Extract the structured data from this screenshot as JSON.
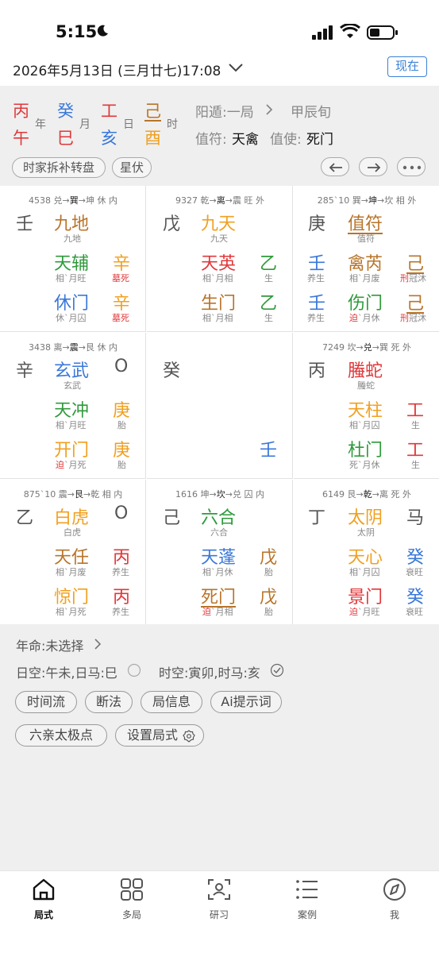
{
  "status": {
    "time": "5:15"
  },
  "header": {
    "date": "2026年5月13日 (三月廿七)17:08",
    "now_button": "现在"
  },
  "pillars": {
    "top": [
      "丙",
      "癸",
      "工",
      "己"
    ],
    "bottom": [
      "午",
      "巳",
      "亥",
      "酉"
    ],
    "labels": [
      "年",
      "月",
      "日",
      "时"
    ]
  },
  "info": {
    "yangdun": "阳遁:一局",
    "xun": "甲辰旬",
    "zhifu_label": "值符:",
    "zhifu_value": "天禽",
    "zhishi_label": "值使:",
    "zhishi_value": "死门",
    "chip1": "时家拆补转盘",
    "chip2": "星伏"
  },
  "palaces": [
    {
      "hdr_num": "4538",
      "hdr_a": "兑→",
      "hdr_b": "巽",
      "hdr_c": "→坤 休 内",
      "left_stem": "壬",
      "god": "九地",
      "god_sub": "九地",
      "star": "天辅",
      "star_sub": "相`月旺",
      "star_stem": "辛",
      "star_stem_sub": "墓死",
      "door": "休门",
      "door_sub": "休`月囚",
      "door_stem": "辛",
      "door_stem_sub": "墓死"
    },
    {
      "hdr_num": "9327",
      "hdr_a": "乾→",
      "hdr_b": "离",
      "hdr_c": "→震 旺 外",
      "left_stem": "戊",
      "god": "九天",
      "god_sub": "九天",
      "star": "天英",
      "star_sub": "相`月相",
      "star_stem": "乙",
      "star_stem_sub": "生",
      "door": "生门",
      "door_sub": "相`月相",
      "door_stem": "乙",
      "door_stem_sub": "生"
    },
    {
      "hdr_num": "285`10",
      "hdr_a": "巽→",
      "hdr_b": "坤",
      "hdr_c": "→坎 相 外",
      "left_stem": "庚",
      "god": "值符",
      "god_sub": "值符",
      "star_left": "壬",
      "star_left_sub": "养生",
      "star": "禽芮",
      "star_sub": "相`月废",
      "star_stem": "己",
      "star_stem_sub_red": "刑",
      "star_stem_sub": "冠沐",
      "door_left": "壬",
      "door_left_sub": "养生",
      "door": "伤门",
      "door_sub_red": "迫",
      "door_sub": "`月休",
      "door_stem": "己",
      "door_stem_sub_red": "刑",
      "door_stem_sub": "冠沐"
    },
    {
      "hdr_num": "3438",
      "hdr_a": "离→",
      "hdr_b": "震",
      "hdr_c": "→艮 休 内",
      "left_stem": "辛",
      "god": "玄武",
      "god_sub": "玄武",
      "right_mark": "O",
      "star": "天冲",
      "star_sub": "相`月旺",
      "star_stem": "庚",
      "star_stem_sub": "胎",
      "door": "开门",
      "door_sub_red": "迫",
      "door_sub": "`月死",
      "door_stem": "庚",
      "door_stem_sub": "胎"
    },
    {
      "center_top": "癸",
      "center_bottom": "壬"
    },
    {
      "hdr_num": "7249",
      "hdr_a": "坎→",
      "hdr_b": "兑",
      "hdr_c": "→巽 死 外",
      "left_stem": "丙",
      "god": "螣蛇",
      "god_sub": "螣蛇",
      "star": "天柱",
      "star_sub": "相`月囚",
      "star_stem": "工",
      "star_stem_sub": "生",
      "door": "杜门",
      "door_sub": "死`月休",
      "door_stem": "工",
      "door_stem_sub": "生"
    },
    {
      "hdr_num": "875`10",
      "hdr_a": "震→",
      "hdr_b": "艮",
      "hdr_c": "→乾 相 内",
      "left_stem": "乙",
      "god": "白虎",
      "god_sub": "白虎",
      "right_mark": "O",
      "star": "天任",
      "star_sub": "相`月废",
      "star_stem": "丙",
      "star_stem_sub": "养生",
      "door": "惊门",
      "door_sub": "相`月死",
      "door_stem": "丙",
      "door_stem_sub": "养生"
    },
    {
      "hdr_num": "1616",
      "hdr_a": "坤→",
      "hdr_b": "坎",
      "hdr_c": "→兑 囚 内",
      "left_stem": "己",
      "god": "六合",
      "god_sub": "六合",
      "star": "天蓬",
      "star_sub": "相`月休",
      "star_stem": "戊",
      "star_stem_sub": "胎",
      "door": "死门",
      "door_sub_red": "迫",
      "door_sub": "`月相",
      "door_stem": "戊",
      "door_stem_sub": "胎"
    },
    {
      "hdr_num": "6149",
      "hdr_a": "艮→",
      "hdr_b": "乾",
      "hdr_c": "→离 死 外",
      "left_stem": "丁",
      "god": "太阴",
      "god_sub": "太阴",
      "right_mark": "马",
      "star": "天心",
      "star_sub": "相`月囚",
      "star_stem": "癸",
      "star_stem_sub": "衰旺",
      "door": "景门",
      "door_sub_red": "迫",
      "door_sub": "`月旺",
      "door_stem": "癸",
      "door_stem_sub": "衰旺"
    }
  ],
  "lower": {
    "nianming": "年命:未选择",
    "rikong": "日空:午未,日马:巳",
    "shikong": "时空:寅卯,时马:亥",
    "buttons": [
      "时间流",
      "断法",
      "局信息",
      "Ai提示词",
      "六亲太极点",
      "设置局式"
    ]
  },
  "tabs": [
    "局式",
    "多局",
    "研习",
    "案例",
    "我"
  ],
  "colors": {
    "red": "#e0383b",
    "blue": "#3a78d8",
    "green": "#2f9a3b",
    "orange": "#f0a020",
    "brown": "#b8742a"
  }
}
